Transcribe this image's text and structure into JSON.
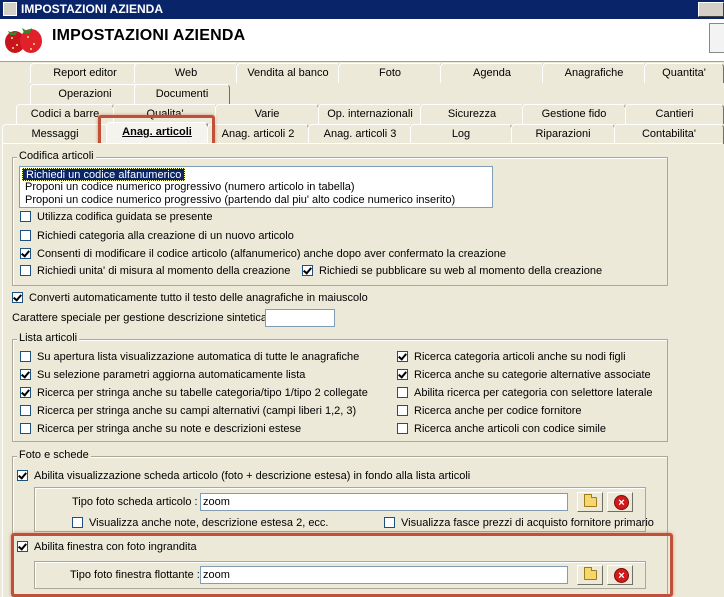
{
  "window": {
    "title": "IMPOSTAZIONI AZIENDA",
    "header_title": "IMPOSTAZIONI AZIENDA"
  },
  "tabs": {
    "row1": [
      "Report editor",
      "Web",
      "Vendita al banco",
      "Foto",
      "Agenda",
      "Anagrafiche",
      "Quantita'"
    ],
    "row2": [
      "Operazioni",
      "Documenti"
    ],
    "row3": [
      "Codici a barre",
      "Qualita'",
      "Varie",
      "Op. internazionali",
      "Sicurezza",
      "Gestione fido",
      "Cantieri"
    ],
    "row4": [
      "Messaggi",
      "Anag. articoli",
      "Anag. articoli 2",
      "Anag. articoli 3",
      "Log",
      "Riparazioni",
      "Contabilita'"
    ],
    "active": "Anag. articoli"
  },
  "codifica": {
    "title": "Codifica articoli",
    "list": [
      "Richiedi un codice alfanumerico",
      "Proponi un codice numerico progressivo (numero articolo in tabella)",
      "Proponi un codice numerico progressivo (partendo dal piu' alto codice numerico inserito)"
    ],
    "selected_index": 0,
    "options": [
      {
        "label": "Utilizza codifica guidata se presente",
        "checked": false
      },
      {
        "label": "Richiedi categoria alla creazione di un nuovo articolo",
        "checked": false
      },
      {
        "label": "Consenti di modificare il codice articolo (alfanumerico) anche dopo aver confermato la creazione",
        "checked": true
      },
      {
        "label": "Richiedi unita' di misura al momento della creazione",
        "checked": false
      },
      {
        "label": "Richiedi se pubblicare su web al momento della creazione",
        "checked": true
      }
    ]
  },
  "general": {
    "maiuscolo": {
      "label": "Converti automaticamente tutto il testo delle anagrafiche in maiuscolo",
      "checked": true
    },
    "carattere_label": "Carattere speciale per gestione descrizione sintetica :",
    "carattere_value": ""
  },
  "lista": {
    "title": "Lista articoli",
    "left": [
      {
        "label": "Su apertura lista visualizzazione automatica di tutte le anagrafiche",
        "checked": false
      },
      {
        "label": "Su selezione parametri aggiorna automaticamente lista",
        "checked": true
      },
      {
        "label": "Ricerca per stringa anche su tabelle categoria/tipo 1/tipo 2 collegate",
        "checked": true
      },
      {
        "label": "Ricerca per stringa anche su campi alternativi (campi liberi 1,2, 3)",
        "checked": false
      },
      {
        "label": "Ricerca per stringa anche su note e descrizioni estese",
        "checked": false
      }
    ],
    "right": [
      {
        "label": "Ricerca categoria articoli anche su nodi figli",
        "checked": true
      },
      {
        "label": "Ricerca anche su categorie alternative associate",
        "checked": true
      },
      {
        "label": "Abilita ricerca per categoria con selettore laterale",
        "checked": false
      },
      {
        "label": "Ricerca anche per codice fornitore",
        "checked": false
      },
      {
        "label": "Ricerca anche articoli con codice simile",
        "checked": false
      }
    ]
  },
  "foto": {
    "title": "Foto e schede",
    "abilita_scheda": {
      "label": "Abilita visualizzazione scheda articolo (foto + descrizione estesa) in fondo alla lista articoli",
      "checked": true
    },
    "tipo_scheda_label": "Tipo foto scheda articolo :",
    "tipo_scheda_value": "zoom",
    "visualizza_note": {
      "label": "Visualizza anche note, descrizione estesa 2, ecc.",
      "checked": false
    },
    "visualizza_fasce": {
      "label": "Visualizza fasce prezzi di acquisto fornitore primario",
      "checked": false
    },
    "abilita_finestra": {
      "label": "Abilita finestra con foto ingrandita",
      "checked": true
    },
    "tipo_finestra_label": "Tipo foto finestra flottante :",
    "tipo_finestra_value": "zoom"
  },
  "icons": {
    "browse": "folder-icon",
    "clear": "delete-icon"
  },
  "colors": {
    "highlight": "#c0503a",
    "titlebar": "#0a246a",
    "selection": "#0a246a"
  }
}
